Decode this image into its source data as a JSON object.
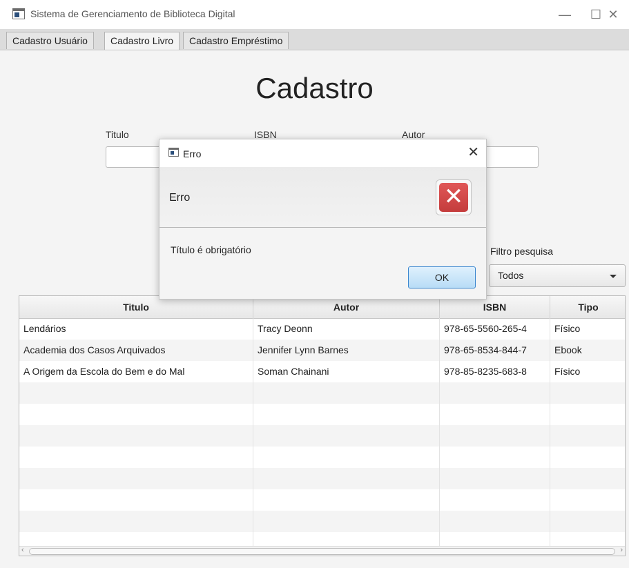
{
  "window": {
    "title": "Sistema de Gerenciamento de Biblioteca Digital",
    "minimize": "—",
    "maximize": "☐",
    "close": "✕"
  },
  "tabs": [
    {
      "label": "Cadastro Usuário"
    },
    {
      "label": "Cadastro Livro",
      "active": true
    },
    {
      "label": "Cadastro Empréstimo"
    }
  ],
  "form": {
    "heading": "Cadastro",
    "labels": {
      "titulo": "Titulo",
      "isbn": "ISBN",
      "autor": "Autor"
    },
    "filter_label": "Filtro pesquisa",
    "filter_value": "Todos"
  },
  "table": {
    "headers": [
      "Titulo",
      "Autor",
      "ISBN",
      "Tipo"
    ],
    "rows": [
      [
        "Lendários",
        "Tracy Deonn",
        "978-65-5560-265-4",
        "Físico"
      ],
      [
        "Academia dos Casos Arquivados",
        "Jennifer Lynn Barnes",
        "978-65-8534-844-7",
        "Ebook"
      ],
      [
        "A Origem da Escola do Bem e do Mal",
        "Soman Chainani",
        "978-85-8235-683-8",
        "Físico"
      ]
    ]
  },
  "dialog": {
    "title": "Erro",
    "header": "Erro",
    "message": "Título é obrigatório",
    "ok_label": "OK",
    "close": "✕",
    "error_glyph": "✕"
  }
}
